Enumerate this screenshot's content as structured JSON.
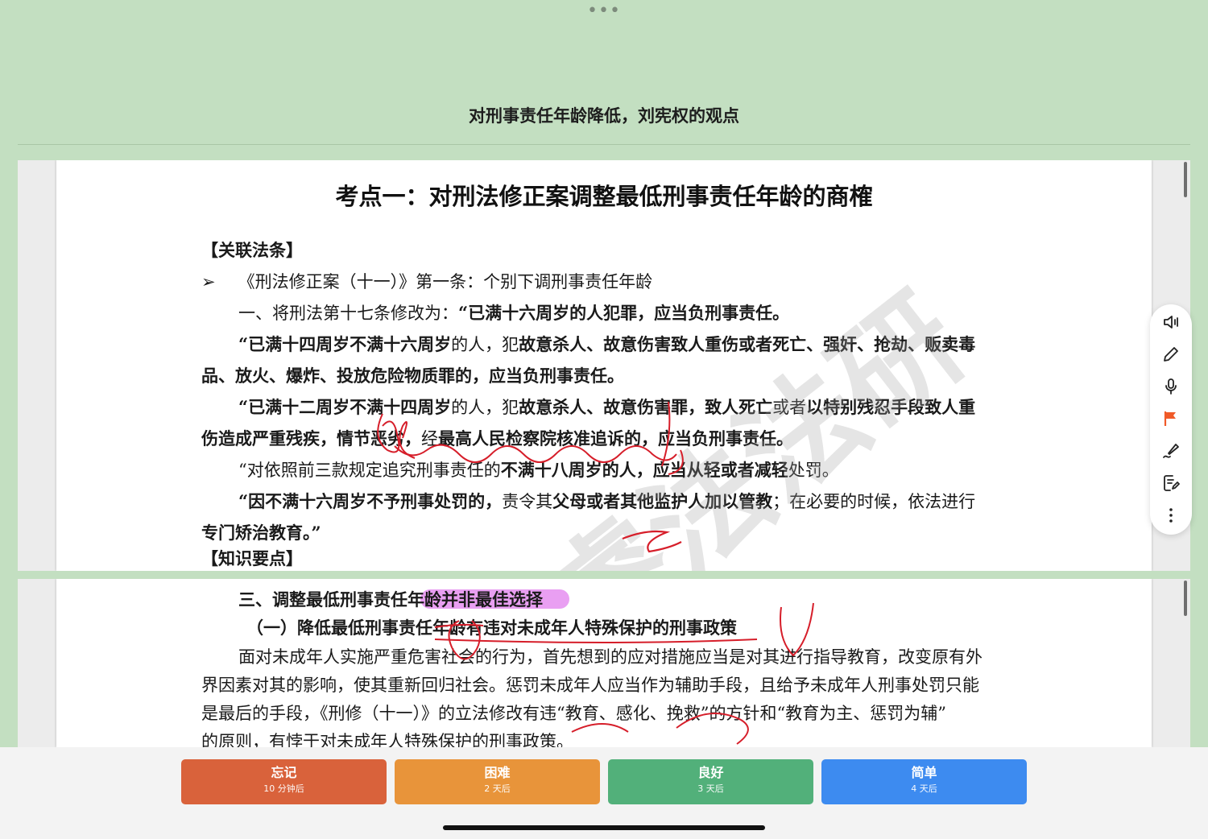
{
  "window": {
    "menu_dots": "•••"
  },
  "card": {
    "title": "对刑事责任年龄降低，刘宪权的观点"
  },
  "page1": {
    "heading": "考点一：对刑法修正案调整最低刑事责任年龄的商榷",
    "section_label": "【关联法条】",
    "bullet": "➢",
    "bullet_text": "《刑法修正案（十一）》第一条：个别下调刑事责任年龄",
    "l1a": "一、将刑法第十七条修改为：",
    "l1b": "“已满十六周岁的人犯罪，应当负刑事责任。",
    "l2a": "“已满十四周岁不满十六周岁",
    "l2b": "的人，犯",
    "l2c": "故意杀人、故意伤害致人重伤或者死亡、强奸、抢劫、贩卖毒",
    "l3": "品、放火、爆炸、投放危险物质罪的，应当负刑事责任。",
    "l4a": "“已满十二周岁不满十四周岁",
    "l4b": "的人，犯",
    "l4c": "故意杀人、故意伤害罪，致人死亡",
    "l4d": "或者",
    "l4e": "以特别残忍手段致人重",
    "l5a": "伤造成严重残疾，情节恶劣，",
    "l5b": "经",
    "l5c": "最高人民检察院核准追诉",
    "l5d": "的，应当负刑事责任。",
    "l6a": "“对依照前三款规定追究刑事责任的",
    "l6b": "不满十八周岁的人，应当从轻或者减轻",
    "l6c": "处罚。",
    "l7a": "“因不满十六周岁不予刑事处罚的，",
    "l7b": "责令其",
    "l7c": "父母或者其他监护人加以管教",
    "l7d": "；在必要的时候，依法进行",
    "l8": "专门矫治教育。”",
    "section_label_2": "【知识要点】"
  },
  "page2": {
    "h1": "三、调整最低刑事责任年龄并非最佳选择",
    "h2": "（一）降低最低刑事责任年龄有违对未成年人特殊保护的刑事政策",
    "p1": "面对未成年人实施严重危害社会的行为，首先想到的应对措施应当是对其进行指导教育，改变原有外",
    "p2": "界因素对其的影响，使其重新回归社会。惩罚未成年人应当作为辅助手段，且给予未成年人刑事处罚只能",
    "p3": "是最后的手段，《刑修（十一）》的立法修改有违“教育、感化、挽救”的方针和“教育为主、惩罚为辅”",
    "p4": "的原则，有悖于对未成年人特殊保护的刑事政策。"
  },
  "watermark": "睿法法研",
  "toolbar": {
    "icons": [
      "speaker-icon",
      "pencil-icon",
      "microphone-icon",
      "flag-icon",
      "signature-pen-icon",
      "note-edit-icon",
      "more-vertical-icon"
    ],
    "flag_color": "#f05a28"
  },
  "ratings": [
    {
      "label": "忘记",
      "interval": "10 分钟后",
      "color": "#d9623b"
    },
    {
      "label": "困难",
      "interval": "2 天后",
      "color": "#e8943a"
    },
    {
      "label": "良好",
      "interval": "3 天后",
      "color": "#52b07a"
    },
    {
      "label": "简单",
      "interval": "4 天后",
      "color": "#3d8bf0"
    }
  ],
  "highlight_color": "#e58ef0"
}
